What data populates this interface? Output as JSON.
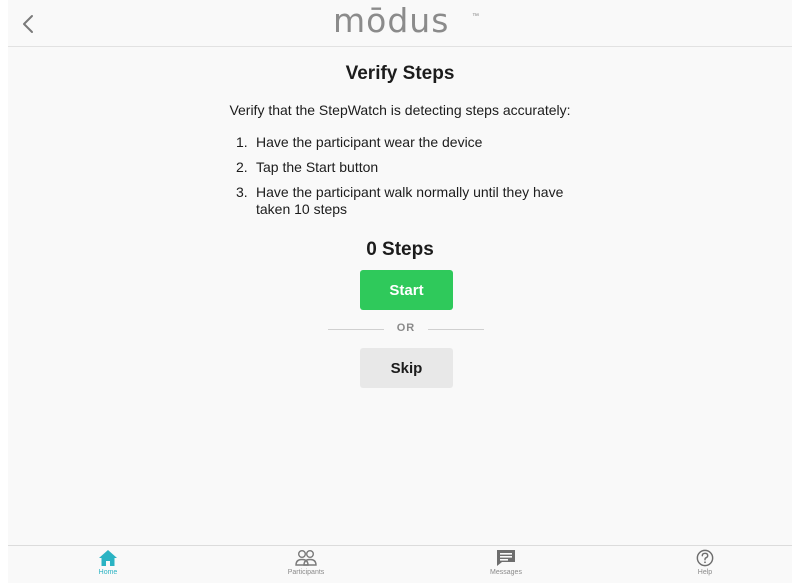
{
  "header": {
    "logo_text": "mōdus",
    "logo_tm": "™",
    "back_icon": "chevron-left-icon"
  },
  "main": {
    "title": "Verify Steps",
    "intro": "Verify that the StepWatch is detecting steps accurately:",
    "steps": [
      {
        "num": "1.",
        "text": "Have the participant wear the device"
      },
      {
        "num": "2.",
        "text": "Tap the Start button"
      },
      {
        "num": "3.",
        "text": "Have the participant walk normally until they have taken 10 steps"
      }
    ],
    "step_count": "0 Steps",
    "start_label": "Start",
    "or_label": "OR",
    "skip_label": "Skip"
  },
  "tabbar": {
    "tabs": [
      {
        "label": "Home",
        "icon": "home-icon",
        "active": true
      },
      {
        "label": "Participants",
        "icon": "participants-icon",
        "active": false
      },
      {
        "label": "Messages",
        "icon": "messages-icon",
        "active": false
      },
      {
        "label": "Help",
        "icon": "help-icon",
        "active": false
      }
    ]
  },
  "colors": {
    "accent": "#2ab3c3",
    "start_button": "#2fc95b",
    "skip_button": "#e8e8e8",
    "background": "#f9f9f9"
  }
}
